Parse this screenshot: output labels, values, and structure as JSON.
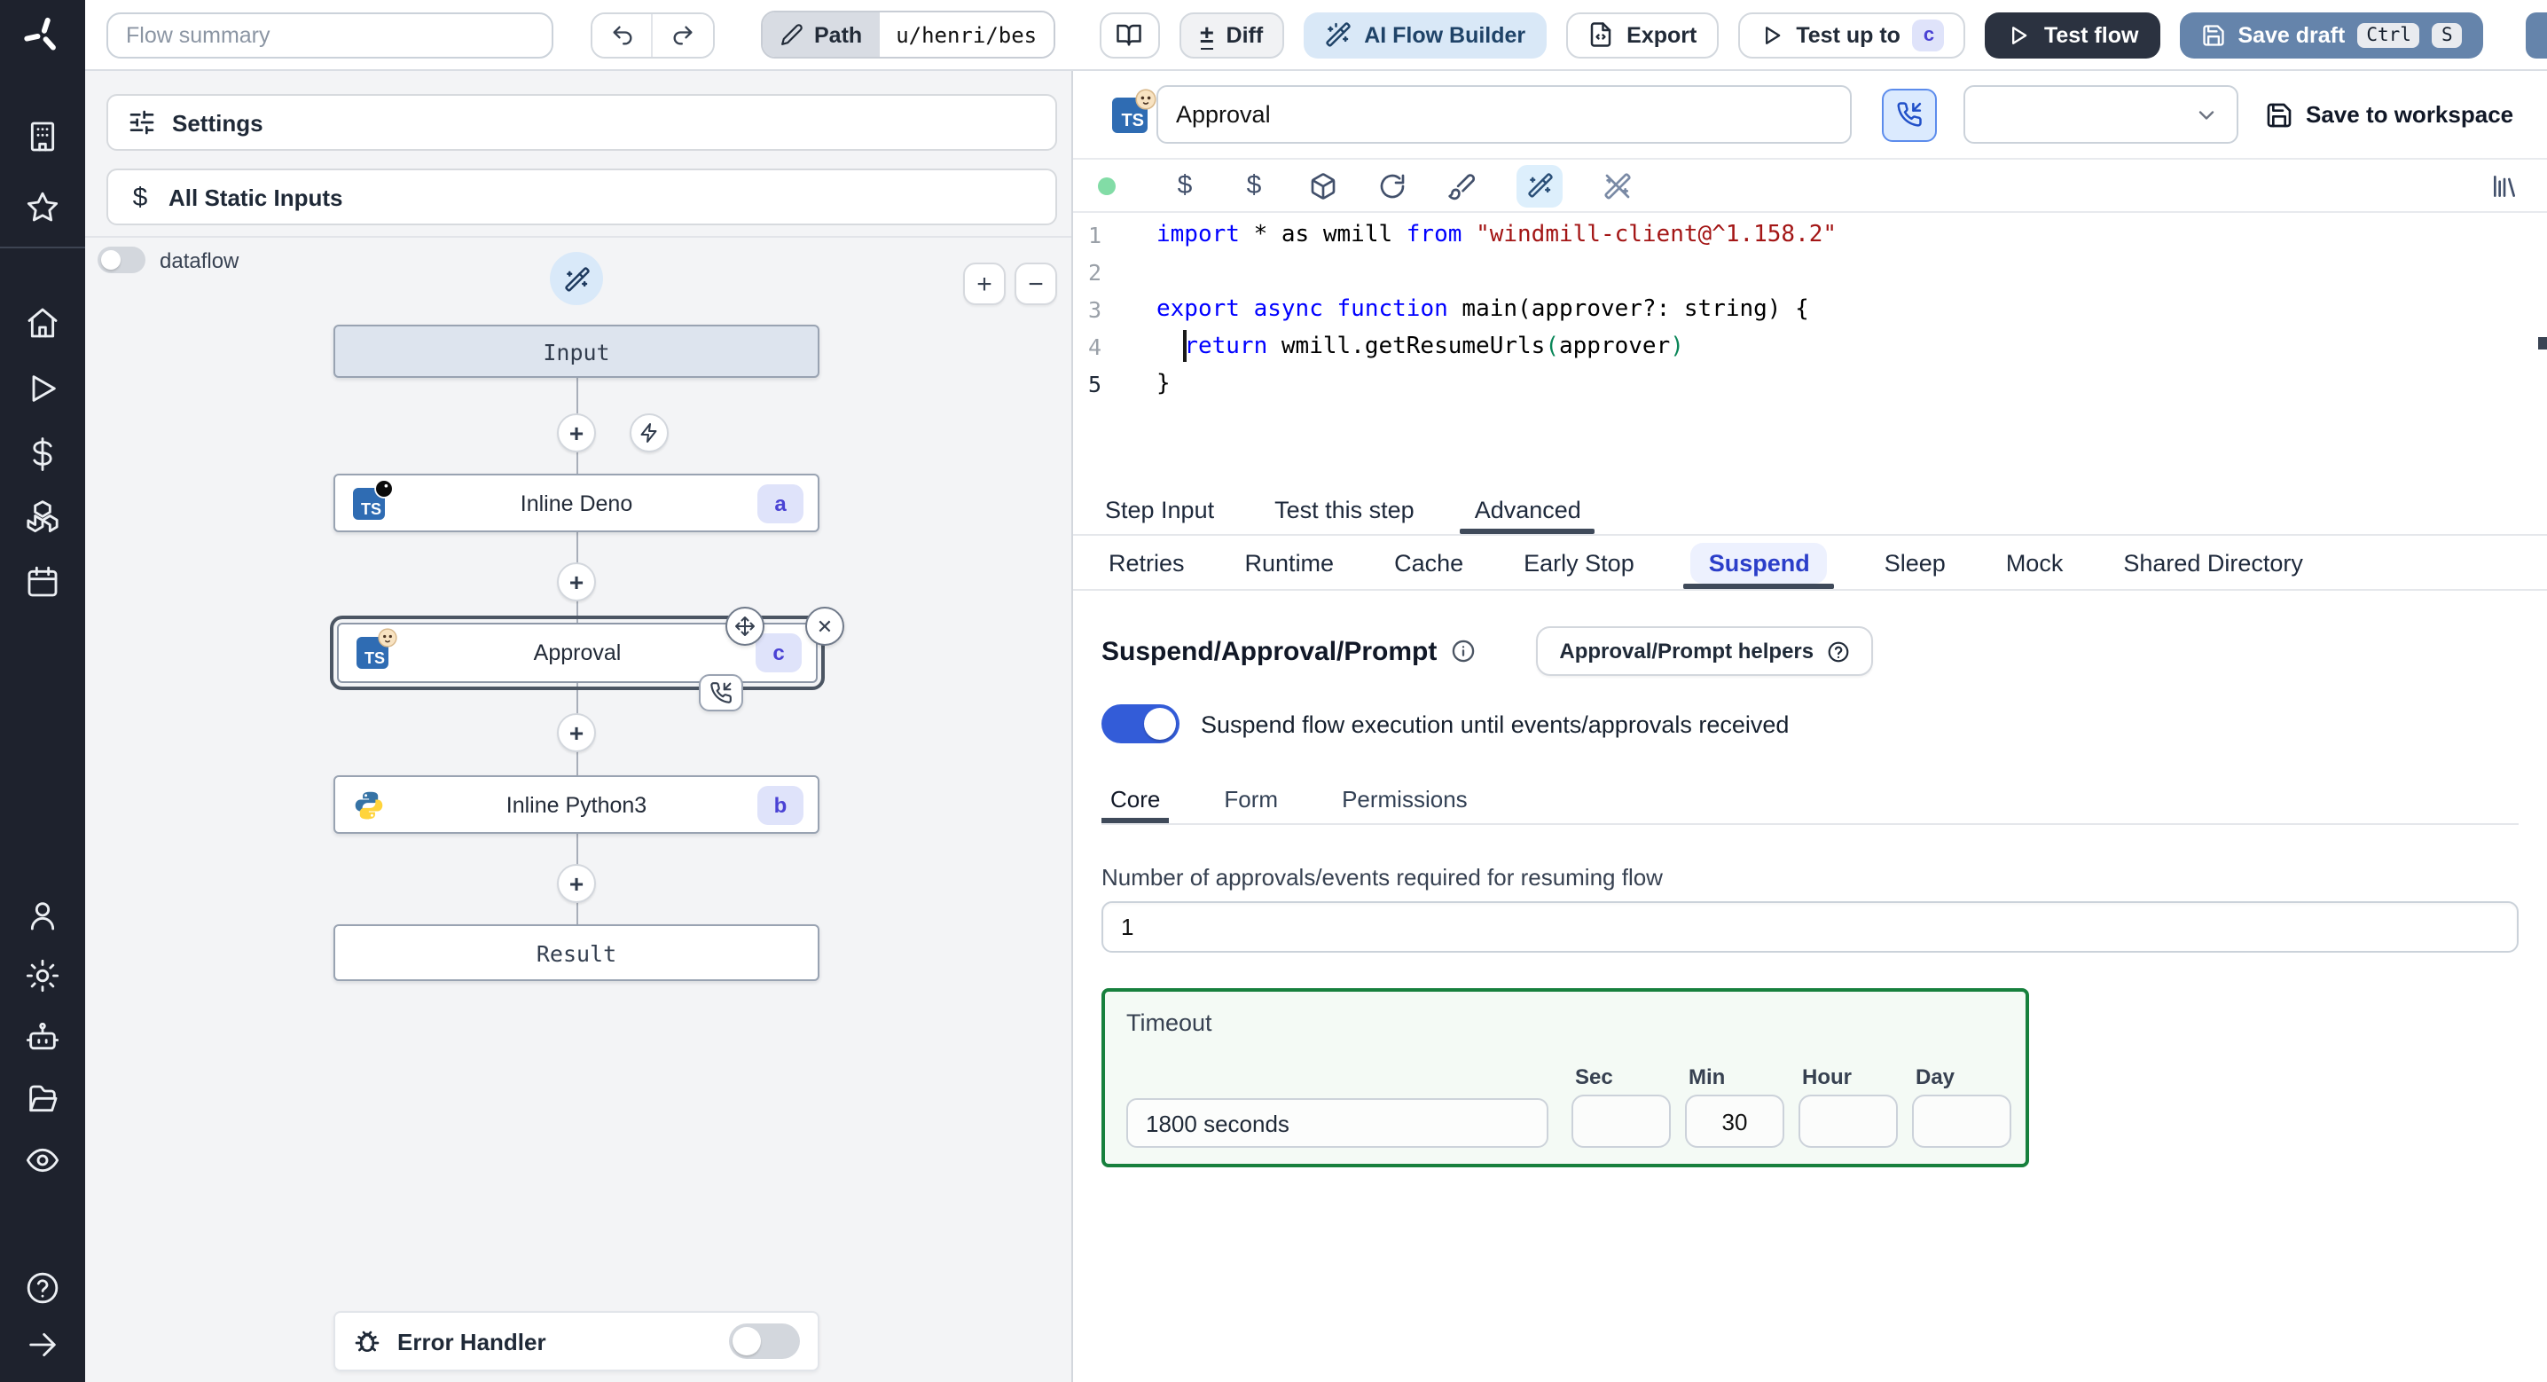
{
  "icons": {
    "add": "+",
    "remove": "−",
    "close": "✕",
    "diff": "±",
    "dollar": "$"
  },
  "topbar": {
    "flow_summary_placeholder": "Flow summary",
    "path_label": "Path",
    "path_value": "u/henri/bes",
    "diff_label": "Diff",
    "ai_flow_builder_label": "AI Flow Builder",
    "export_label": "Export",
    "test_up_to_label": "Test up to",
    "test_up_to_badge": "c",
    "test_flow_label": "Test flow",
    "save_draft_label": "Save draft",
    "kbd_ctrl": "Ctrl",
    "kbd_s": "S"
  },
  "left_panel": {
    "settings_label": "Settings",
    "static_inputs_label": "All Static Inputs",
    "dataflow_label": "dataflow",
    "graph": {
      "input_label": "Input",
      "deno": {
        "label": "Inline Deno",
        "badge": "a"
      },
      "approval": {
        "label": "Approval",
        "badge": "c"
      },
      "python": {
        "label": "Inline Python3",
        "badge": "b"
      },
      "result_label": "Result"
    },
    "error_handler_label": "Error Handler"
  },
  "editor": {
    "step_name_value": "Approval",
    "save_to_workspace_label": "Save to workspace",
    "code": {
      "lines": [
        {
          "num": "1",
          "active": false,
          "tokens": [
            {
              "t": "import",
              "c": "kw"
            },
            {
              "t": " * as wmill ",
              "c": "pl"
            },
            {
              "t": "from",
              "c": "kw"
            },
            {
              "t": " ",
              "c": "pl"
            },
            {
              "t": "\"windmill-client@^1.158.2\"",
              "c": "str"
            }
          ]
        },
        {
          "num": "2",
          "active": false,
          "tokens": []
        },
        {
          "num": "3",
          "active": false,
          "tokens": [
            {
              "t": "export",
              "c": "kw"
            },
            {
              "t": " ",
              "c": "pl"
            },
            {
              "t": "async",
              "c": "kw"
            },
            {
              "t": " ",
              "c": "pl"
            },
            {
              "t": "function",
              "c": "kw"
            },
            {
              "t": " main(approver?: string) {",
              "c": "pl"
            }
          ]
        },
        {
          "num": "4",
          "active": false,
          "tokens": [
            {
              "t": "  ",
              "c": "pl"
            },
            {
              "t": "return",
              "c": "kw"
            },
            {
              "t": " wmill.getResumeUrls",
              "c": "pl"
            },
            {
              "t": "(",
              "c": "pr"
            },
            {
              "t": "approver",
              "c": "pl"
            },
            {
              "t": ")",
              "c": "pr"
            }
          ]
        },
        {
          "num": "5",
          "active": true,
          "tokens": [
            {
              "t": "}",
              "c": "pl"
            }
          ]
        }
      ]
    }
  },
  "tabs": {
    "main": [
      "Step Input",
      "Test this step",
      "Advanced"
    ],
    "active_main": "Advanced",
    "advanced": [
      "Retries",
      "Runtime",
      "Cache",
      "Early Stop",
      "Suspend",
      "Sleep",
      "Mock",
      "Shared Directory"
    ],
    "active_advanced": "Suspend",
    "suspend_sub": [
      "Core",
      "Form",
      "Permissions"
    ],
    "active_suspend_sub": "Core"
  },
  "suspend": {
    "heading": "Suspend/Approval/Prompt",
    "helpers_button_label": "Approval/Prompt helpers",
    "toggle_label": "Suspend flow execution until events/approvals received",
    "toggle_on": true,
    "approvals_label": "Number of approvals/events required for resuming flow",
    "approvals_value": "1",
    "timeout": {
      "label": "Timeout",
      "display_value": "1800 seconds",
      "units": [
        {
          "label": "Sec",
          "value": ""
        },
        {
          "label": "Min",
          "value": "30"
        },
        {
          "label": "Hour",
          "value": ""
        },
        {
          "label": "Day",
          "value": ""
        }
      ]
    }
  },
  "colors": {
    "toggle": "#335cd8",
    "suspend_text": "#2b3ec9",
    "suspend_bg": "#edf1fe",
    "green_border": "#17803d",
    "green_bg": "#f4faf5",
    "badge_bg": "#dfe3fa",
    "badge_text": "#4a42d4",
    "save_draft": "#6584ab",
    "test_flow": "#2b3240",
    "ai_bg": "#d9e8f7",
    "ai_text": "#1f4368",
    "status_green": "#82dca6",
    "phone_bg": "#dbeafe",
    "phone_border": "#5c8cec",
    "phone_icon": "#2150c8",
    "ts_blue": "#2f6cb3",
    "kw": "#0000ff",
    "str": "#a31515",
    "paren": "#098658",
    "input_node_bg": "#dde4ee"
  }
}
